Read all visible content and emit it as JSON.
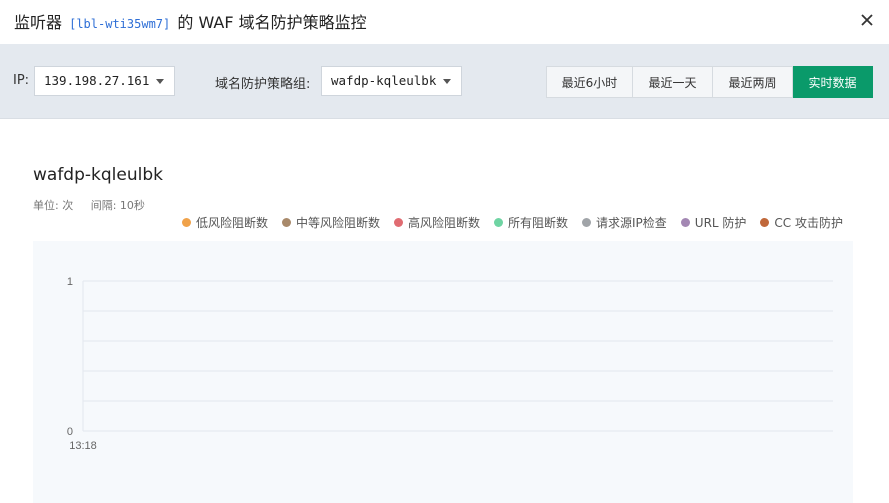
{
  "header": {
    "title_prefix": "监听器",
    "listener_id": "[lbl-wti35wm7]",
    "title_suffix": "的 WAF 域名防护策略监控"
  },
  "toolbar": {
    "ip_label": "IP:",
    "ip_value": "139.198.27.161",
    "policy_group_label": "域名防护策略组:",
    "policy_group_value": "wafdp-kqleulbk",
    "time_buttons": [
      {
        "label": "最近6小时",
        "active": false
      },
      {
        "label": "最近一天",
        "active": false
      },
      {
        "label": "最近两周",
        "active": false
      },
      {
        "label": "实时数据",
        "active": true
      }
    ]
  },
  "chart": {
    "title": "wafdp-kqleulbk",
    "unit": "单位: 次",
    "interval": "间隔: 10秒",
    "legend": [
      {
        "label": "低风险阻断数",
        "color": "#f0a24a"
      },
      {
        "label": "中等风险阻断数",
        "color": "#a8896a"
      },
      {
        "label": "高风险阻断数",
        "color": "#e06c72"
      },
      {
        "label": "所有阻断数",
        "color": "#6fd4a3"
      },
      {
        "label": "请求源IP检查",
        "color": "#a0a4a8"
      },
      {
        "label": "URL 防护",
        "color": "#a387b3"
      },
      {
        "label": "CC 攻击防护",
        "color": "#c0683a"
      }
    ]
  },
  "chart_data": {
    "type": "line",
    "x": [
      "13:18"
    ],
    "ylim": [
      0,
      1
    ],
    "yticks": [
      "1",
      "0"
    ],
    "xticks": [
      "13:18"
    ],
    "series": [],
    "grid": true,
    "legend_position": "top-right"
  }
}
